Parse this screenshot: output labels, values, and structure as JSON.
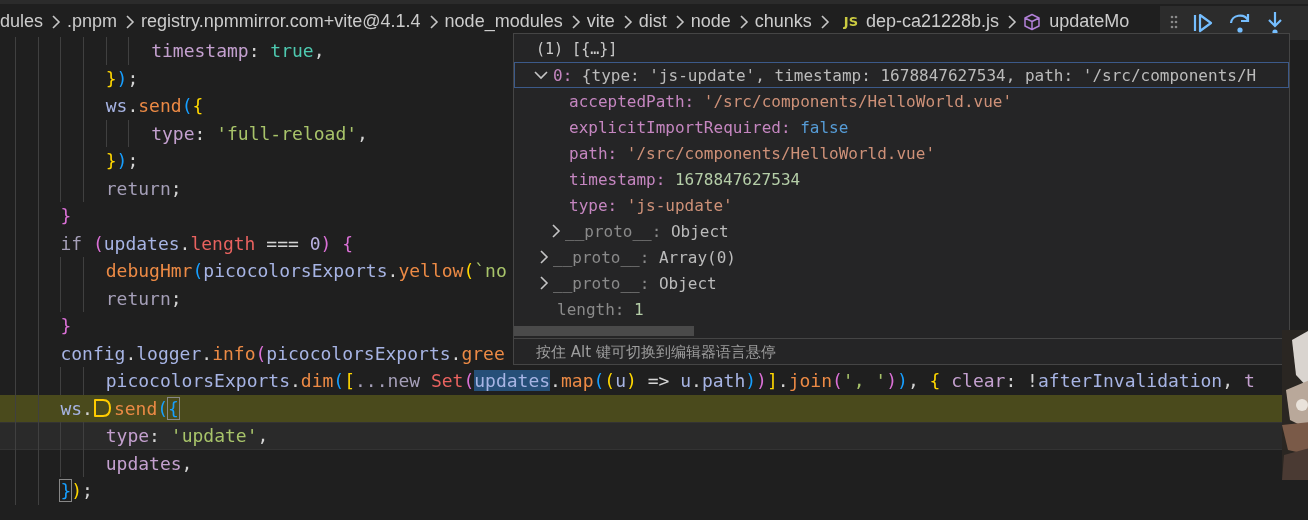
{
  "breadcrumb": [
    {
      "label": "dules",
      "kind": "folder"
    },
    {
      "label": ".pnpm",
      "kind": "folder"
    },
    {
      "label": "registry.npmmirror.com+vite@4.1.4",
      "kind": "folder"
    },
    {
      "label": "node_modules",
      "kind": "folder"
    },
    {
      "label": "vite",
      "kind": "folder"
    },
    {
      "label": "dist",
      "kind": "folder"
    },
    {
      "label": "node",
      "kind": "folder"
    },
    {
      "label": "chunks",
      "kind": "folder"
    },
    {
      "label": "dep-ca21228b.js",
      "kind": "js-file",
      "icon_text": "JS"
    },
    {
      "label": "updateMo",
      "kind": "symbol"
    }
  ],
  "code": [
    {
      "paused": false,
      "cursor": false,
      "tokens": [
        {
          "t": "            timestamp",
          "kind": "prop"
        },
        {
          "t": ": ",
          "kind": "p"
        },
        {
          "t": "true",
          "kind": "bool"
        },
        {
          "t": ",",
          "kind": "p"
        }
      ]
    },
    {
      "paused": false,
      "cursor": false,
      "tokens": [
        {
          "t": "        }",
          "kind": "b1"
        },
        {
          "t": ")",
          "kind": "b3"
        },
        {
          "t": ";",
          "kind": "p"
        }
      ]
    },
    {
      "paused": false,
      "cursor": false,
      "tokens": [
        {
          "t": "        ws",
          "kind": "var"
        },
        {
          "t": ".",
          "kind": "p"
        },
        {
          "t": "send",
          "kind": "fn"
        },
        {
          "t": "(",
          "kind": "b3"
        },
        {
          "t": "{",
          "kind": "b1"
        }
      ]
    },
    {
      "paused": false,
      "cursor": false,
      "tokens": [
        {
          "t": "            type",
          "kind": "prop"
        },
        {
          "t": ": ",
          "kind": "p"
        },
        {
          "t": "'full-reload'",
          "kind": "str"
        },
        {
          "t": ",",
          "kind": "p"
        }
      ]
    },
    {
      "paused": false,
      "cursor": false,
      "tokens": [
        {
          "t": "        }",
          "kind": "b1"
        },
        {
          "t": ")",
          "kind": "b3"
        },
        {
          "t": ";",
          "kind": "p"
        }
      ]
    },
    {
      "paused": false,
      "cursor": false,
      "tokens": [
        {
          "t": "        return",
          "kind": "kw"
        },
        {
          "t": ";",
          "kind": "p"
        }
      ]
    },
    {
      "paused": false,
      "cursor": false,
      "tokens": [
        {
          "t": "    }",
          "kind": "b2"
        }
      ]
    },
    {
      "paused": false,
      "cursor": false,
      "tokens": [
        {
          "t": "    if ",
          "kind": "kw"
        },
        {
          "t": "(",
          "kind": "b2"
        },
        {
          "t": "updates",
          "kind": "var"
        },
        {
          "t": ".",
          "kind": "p"
        },
        {
          "t": "length",
          "kind": "member"
        },
        {
          "t": " === ",
          "kind": "p"
        },
        {
          "t": "0",
          "kind": "num"
        },
        {
          "t": ") ",
          "kind": "b2"
        },
        {
          "t": "{",
          "kind": "b2"
        }
      ]
    },
    {
      "paused": false,
      "cursor": false,
      "tokens": [
        {
          "t": "        debugHmr",
          "kind": "fn"
        },
        {
          "t": "(",
          "kind": "b3"
        },
        {
          "t": "picocolorsExports",
          "kind": "var"
        },
        {
          "t": ".",
          "kind": "p"
        },
        {
          "t": "yellow",
          "kind": "fn"
        },
        {
          "t": "(",
          "kind": "b1"
        },
        {
          "t": "`no",
          "kind": "str"
        }
      ]
    },
    {
      "paused": false,
      "cursor": false,
      "tokens": [
        {
          "t": "        return",
          "kind": "kw"
        },
        {
          "t": ";",
          "kind": "p"
        }
      ]
    },
    {
      "paused": false,
      "cursor": false,
      "tokens": [
        {
          "t": "    }",
          "kind": "b2"
        }
      ]
    },
    {
      "paused": false,
      "cursor": false,
      "tokens": [
        {
          "t": "    config",
          "kind": "var"
        },
        {
          "t": ".",
          "kind": "p"
        },
        {
          "t": "logger",
          "kind": "var"
        },
        {
          "t": ".",
          "kind": "p"
        },
        {
          "t": "info",
          "kind": "fn"
        },
        {
          "t": "(",
          "kind": "b2"
        },
        {
          "t": "picocolorsExports",
          "kind": "var"
        },
        {
          "t": ".",
          "kind": "p"
        },
        {
          "t": "gree",
          "kind": "fn"
        }
      ]
    },
    {
      "paused": false,
      "cursor": false,
      "tokens": [
        {
          "t": "        picocolorsExports",
          "kind": "var"
        },
        {
          "t": ".",
          "kind": "p"
        },
        {
          "t": "dim",
          "kind": "fn"
        },
        {
          "t": "(",
          "kind": "b3"
        },
        {
          "t": "[",
          "kind": "b1"
        },
        {
          "t": "...new ",
          "kind": "kw"
        },
        {
          "t": "Set",
          "kind": "cls"
        },
        {
          "t": "(",
          "kind": "b2"
        },
        {
          "t": "updates",
          "kind": "var-hl"
        },
        {
          "t": ".",
          "kind": "p"
        },
        {
          "t": "map",
          "kind": "fn"
        },
        {
          "t": "(",
          "kind": "b3"
        },
        {
          "t": "(",
          "kind": "b1"
        },
        {
          "t": "u",
          "kind": "var"
        },
        {
          "t": ")",
          "kind": "b1"
        },
        {
          "t": " => ",
          "kind": "p"
        },
        {
          "t": "u",
          "kind": "var"
        },
        {
          "t": ".",
          "kind": "p"
        },
        {
          "t": "path",
          "kind": "var"
        },
        {
          "t": ")",
          "kind": "b3"
        },
        {
          "t": ")",
          "kind": "b2"
        },
        {
          "t": "]",
          "kind": "b1"
        },
        {
          "t": ".",
          "kind": "p"
        },
        {
          "t": "join",
          "kind": "fn"
        },
        {
          "t": "(",
          "kind": "b2"
        },
        {
          "t": "', '",
          "kind": "str"
        },
        {
          "t": ")",
          "kind": "b2"
        },
        {
          "t": ")",
          "kind": "b3"
        },
        {
          "t": ", ",
          "kind": "p"
        },
        {
          "t": "{ ",
          "kind": "b1"
        },
        {
          "t": "clear",
          "kind": "prop"
        },
        {
          "t": ": !",
          "kind": "p"
        },
        {
          "t": "afterInvalidation",
          "kind": "var"
        },
        {
          "t": ", ",
          "kind": "p"
        },
        {
          "t": "t",
          "kind": "prop"
        }
      ]
    },
    {
      "paused": true,
      "cursor": false,
      "tokens": [
        {
          "t": "    ws",
          "kind": "var"
        },
        {
          "t": ".",
          "kind": "p"
        },
        {
          "kind": "frame-marker"
        },
        {
          "t": "send",
          "kind": "fn"
        },
        {
          "t": "(",
          "kind": "b3"
        },
        {
          "t": "{",
          "kind": "b3-boxed"
        }
      ]
    },
    {
      "paused": false,
      "cursor": true,
      "tokens": [
        {
          "t": "        type",
          "kind": "prop"
        },
        {
          "t": ": ",
          "kind": "p"
        },
        {
          "t": "'update'",
          "kind": "str"
        },
        {
          "t": ",",
          "kind": "p"
        }
      ]
    },
    {
      "paused": false,
      "cursor": false,
      "tokens": [
        {
          "t": "        updates",
          "kind": "prop"
        },
        {
          "t": ",",
          "kind": "p"
        }
      ]
    },
    {
      "paused": false,
      "cursor": false,
      "tokens": [
        {
          "t": "    }",
          "kind": "b3-boxed"
        },
        {
          "t": ")",
          "kind": "b1"
        },
        {
          "t": ";",
          "kind": "p"
        }
      ]
    }
  ],
  "hover": {
    "header": "(1) [{…}]",
    "tree": [
      {
        "key": "0:",
        "value": "{type: 'js-update', timestamp: 1678847627534, path: '/src/components/H",
        "color": "#bbbbbb",
        "kind": "group",
        "expanded": true,
        "selected": true,
        "dim": false,
        "children": [
          {
            "key": "acceptedPath:",
            "value": "'/src/components/HelloWorld.vue'",
            "color": "#ce9178",
            "kind": "leaf",
            "selected": false,
            "dim": false
          },
          {
            "key": "explicitImportRequired:",
            "value": "false",
            "color": "#569cd6",
            "kind": "leaf",
            "selected": false,
            "dim": false
          },
          {
            "key": "path:",
            "value": "'/src/components/HelloWorld.vue'",
            "color": "#ce9178",
            "kind": "leaf",
            "selected": false,
            "dim": false
          },
          {
            "key": "timestamp:",
            "value": "1678847627534",
            "color": "#b5cea8",
            "kind": "leaf",
            "selected": false,
            "dim": false
          },
          {
            "key": "type:",
            "value": "'js-update'",
            "color": "#ce9178",
            "kind": "leaf",
            "selected": false,
            "dim": false
          },
          {
            "key": "__proto__:",
            "value": "Object",
            "color": "#bbbbbb",
            "kind": "group",
            "expanded": false,
            "selected": false,
            "dim": true
          }
        ]
      },
      {
        "key": "__proto__:",
        "value": "Array(0)",
        "color": "#bbbbbb",
        "kind": "group",
        "expanded": false,
        "selected": false,
        "dim": true
      },
      {
        "key": "__proto__:",
        "value": "Object",
        "color": "#bbbbbb",
        "kind": "group",
        "expanded": false,
        "selected": false,
        "dim": true
      },
      {
        "key": "length:",
        "value": "1",
        "color": "#b5cea8",
        "kind": "leaf",
        "selected": false,
        "dim": true
      }
    ],
    "hint": "按住 Alt 键可切换到编辑器语言悬停"
  }
}
